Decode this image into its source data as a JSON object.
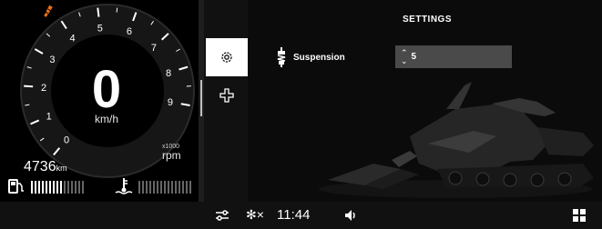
{
  "gauge": {
    "speed": "0",
    "speed_unit": "km/h",
    "rpm_ticks": [
      "0",
      "1",
      "2",
      "3",
      "4",
      "5",
      "6",
      "7",
      "8",
      "9"
    ],
    "rpm_multiplier": "x1000",
    "rpm_unit": "rpm",
    "odometer_value": "4736",
    "odometer_unit": "km",
    "fuel_level": 0.6,
    "temperature_level": 0.0,
    "accent_color": "#e8731a"
  },
  "side_tabs": [
    {
      "icon": "gear-icon",
      "selected": true
    },
    {
      "icon": "plus-outline-icon",
      "selected": false
    }
  ],
  "settings": {
    "title": "SETTINGS",
    "suspension_label": "Suspension",
    "suspension_value": "5",
    "suspension_arrows": [
      "⌃",
      "⌄"
    ]
  },
  "status_bar": {
    "equalizer_icon": "equalizer-icon",
    "bluetooth_icon": "bluetooth-disconnected-icon",
    "bluetooth_symbol": "✻×",
    "time": "11:44",
    "volume_icon": "volume-icon",
    "apps_icon": "apps-grid-icon"
  }
}
